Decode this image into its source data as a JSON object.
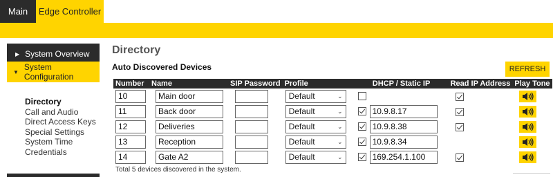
{
  "tabs": [
    {
      "label": "Main"
    },
    {
      "label": "Edge Controller"
    }
  ],
  "sidebar": {
    "items": [
      {
        "label": "System Overview",
        "expanded": false
      },
      {
        "label": "System Configuration",
        "expanded": true
      }
    ],
    "subitems": [
      {
        "label": "Directory",
        "active": true
      },
      {
        "label": "Call and Audio"
      },
      {
        "label": "Direct Access Keys"
      },
      {
        "label": "Special Settings"
      },
      {
        "label": "System Time"
      },
      {
        "label": "Credentials"
      }
    ]
  },
  "page": {
    "title": "Directory",
    "section_title": "Auto Discovered Devices",
    "refresh_label": "REFRESH"
  },
  "table": {
    "headers": [
      "Number",
      "Name",
      "SIP Password",
      "Profile",
      "DHCP / Static IP",
      "Read IP Address",
      "Play Tone"
    ],
    "rows": [
      {
        "number": "10",
        "name": "Main door",
        "sip": "",
        "profile": "Default",
        "dhcp_checked": false,
        "ip": "",
        "read_ip": true
      },
      {
        "number": "11",
        "name": "Back door",
        "sip": "",
        "profile": "Default",
        "dhcp_checked": true,
        "ip": "10.9.8.17",
        "read_ip": true
      },
      {
        "number": "12",
        "name": "Deliveries",
        "sip": "",
        "profile": "Default",
        "dhcp_checked": true,
        "ip": "10.9.8.38",
        "read_ip": true
      },
      {
        "number": "13",
        "name": "Reception",
        "sip": "",
        "profile": "Default",
        "dhcp_checked": true,
        "ip": "10.9.8.34",
        "read_ip": false
      },
      {
        "number": "14",
        "name": "Gate A2",
        "sip": "",
        "profile": "Default",
        "dhcp_checked": true,
        "ip": "169.254.1.100",
        "read_ip": true
      }
    ]
  },
  "footer": {
    "note": "Total 5 devices discovered in the system."
  },
  "icons": {
    "play_tone": "speaker-icon",
    "dropdown": "chevron-down-icon",
    "nav_collapsed": "caret-right-icon",
    "nav_expanded": "caret-down-icon"
  },
  "colors": {
    "accent": "#ffd400",
    "dark": "#2b2b2b"
  }
}
